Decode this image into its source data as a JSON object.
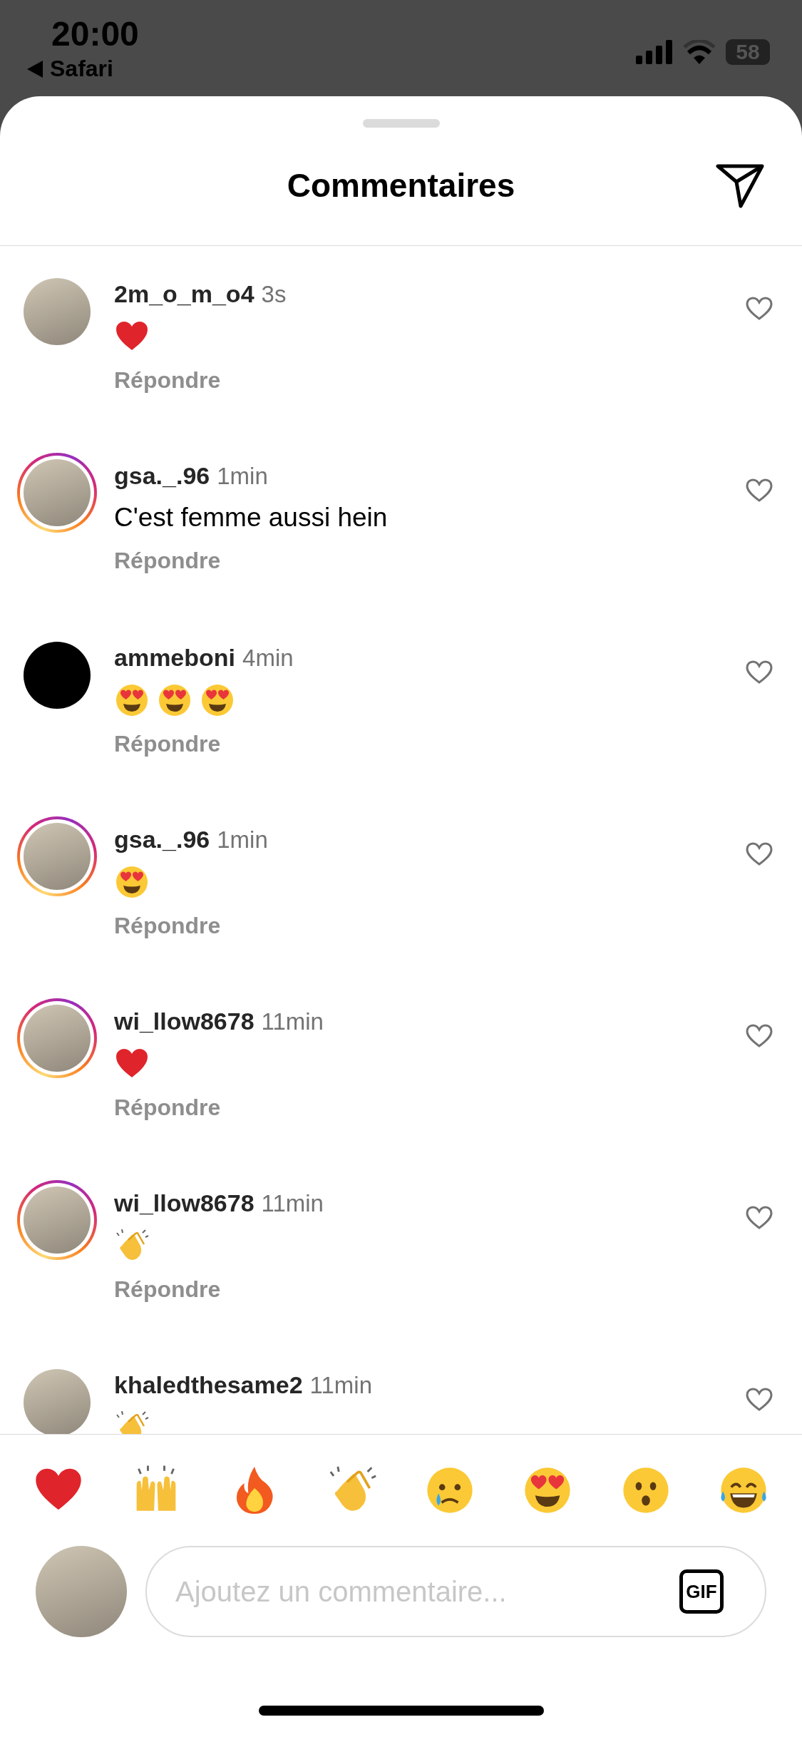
{
  "status_bar": {
    "time": "20:00",
    "back_label": "Safari",
    "battery": "58"
  },
  "header": {
    "title": "Commentaires"
  },
  "comments": [
    {
      "username": "2m_o_m_o4",
      "time": "3s",
      "avatar": {
        "kind": "photo",
        "story_ring": false
      },
      "emojis": [
        {
          "kind": "heart"
        }
      ],
      "reply_label": "Répondre"
    },
    {
      "username": "gsa._.96",
      "time": "1min",
      "avatar": {
        "kind": "photo",
        "story_ring": true
      },
      "text": "C'est femme aussi hein",
      "reply_label": "Répondre"
    },
    {
      "username": "ammeboni",
      "time": "4min",
      "avatar": {
        "kind": "dark",
        "story_ring": false
      },
      "emojis": [
        {
          "kind": "heart-eyes"
        },
        {
          "kind": "heart-eyes"
        },
        {
          "kind": "heart-eyes"
        }
      ],
      "reply_label": "Répondre"
    },
    {
      "username": "gsa._.96",
      "time": "1min",
      "avatar": {
        "kind": "photo",
        "story_ring": true
      },
      "emojis": [
        {
          "kind": "heart-eyes"
        }
      ],
      "reply_label": "Répondre"
    },
    {
      "username": "wi_llow8678",
      "time": "11min",
      "avatar": {
        "kind": "photo",
        "story_ring": true
      },
      "emojis": [
        {
          "kind": "heart"
        }
      ],
      "reply_label": "Répondre"
    },
    {
      "username": "wi_llow8678",
      "time": "11min",
      "avatar": {
        "kind": "photo",
        "story_ring": true
      },
      "emojis": [
        {
          "kind": "clap"
        }
      ],
      "reply_label": "Répondre"
    },
    {
      "username": "khaledthesame2",
      "time": "11min",
      "avatar": {
        "kind": "photo",
        "story_ring": false
      },
      "emojis": [
        {
          "kind": "clap"
        }
      ]
    }
  ],
  "reactions": [
    {
      "kind": "heart"
    },
    {
      "kind": "raised-hands"
    },
    {
      "kind": "fire"
    },
    {
      "kind": "clap"
    },
    {
      "kind": "crying"
    },
    {
      "kind": "heart-eyes"
    },
    {
      "kind": "surprised"
    },
    {
      "kind": "joy"
    }
  ],
  "composer": {
    "placeholder": "Ajoutez un commentaire...",
    "gif_label": "GIF"
  }
}
